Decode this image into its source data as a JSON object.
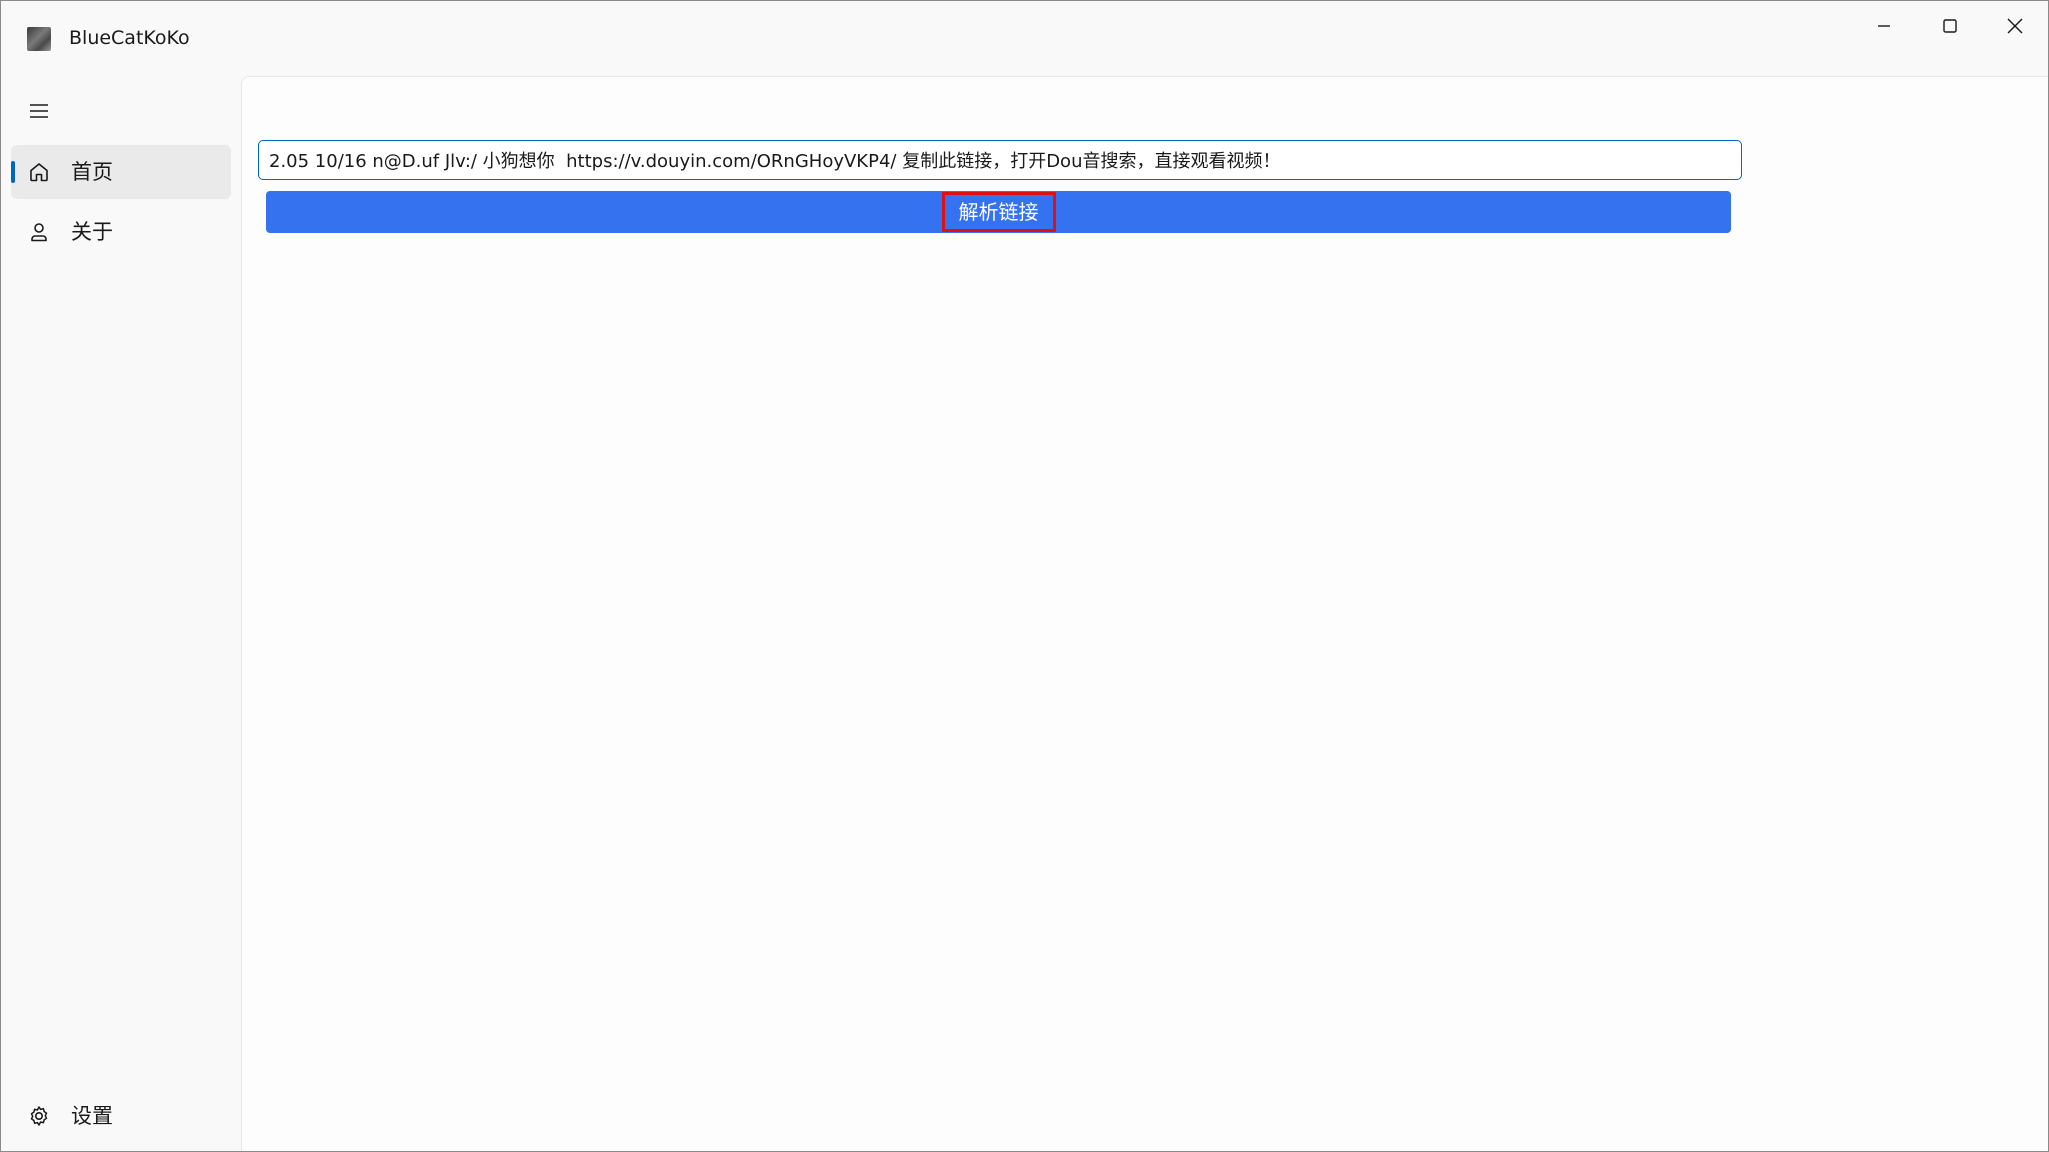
{
  "window": {
    "title": "BlueCatKoKo",
    "controls": {
      "minimize_icon": "minimize-icon",
      "maximize_icon": "maximize-icon",
      "close_icon": "close-icon"
    }
  },
  "sidebar": {
    "menu_icon": "hamburger-menu-icon",
    "items": [
      {
        "label": "首页",
        "icon": "home-icon",
        "active": true
      },
      {
        "label": "关于",
        "icon": "person-icon",
        "active": false
      }
    ],
    "footer_items": [
      {
        "label": "设置",
        "icon": "gear-icon"
      }
    ]
  },
  "main": {
    "link_input": {
      "value": "2.05 10/16 n@D.uf Jlv:/ 小狗想你  https://v.douyin.com/ORnGHoyVKP4/ 复制此链接，打开Dou音搜索，直接观看视频！"
    },
    "parse_button": {
      "label": "解析链接"
    }
  },
  "colors": {
    "accent": "#0067c0",
    "button": "#3472f0",
    "highlight": "#e01010"
  }
}
